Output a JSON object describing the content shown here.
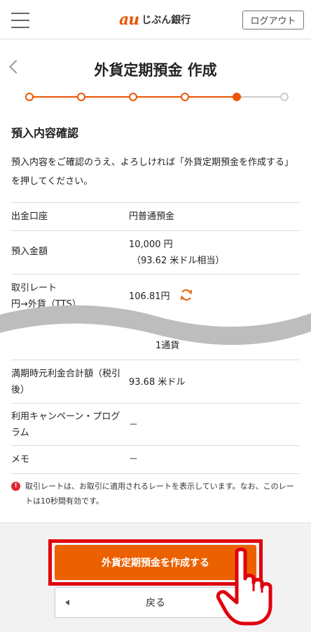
{
  "header": {
    "logo_mark": "au",
    "logo_text": "じぶん銀行",
    "logout_label": "ログアウト"
  },
  "page": {
    "title": "外貨定期預金 作成"
  },
  "stepper": {
    "total_steps": 6,
    "current_step": 5
  },
  "section": {
    "title": "預入内容確認",
    "intro": "預入内容をご確認のうえ、よろしければ「外貨定期預金を作成する」を押してください。"
  },
  "details": {
    "withdrawal_account": {
      "label": "出金口座",
      "value": "円普通預金"
    },
    "deposit_amount": {
      "label": "預入金額",
      "value": "10,000 円",
      "sub": "（93.62 米ドル相当）"
    },
    "rate": {
      "label": "取引レート",
      "sub_label": "円→外貨（TTS）",
      "value": "106.81円"
    },
    "hidden_row": {
      "value": "1通貨"
    },
    "maturity_total": {
      "label": "満期時元利金合計額（税引後）",
      "value": "93.68 米ドル"
    },
    "campaign": {
      "label": "利用キャンペーン・プログラム",
      "value": "－"
    },
    "memo": {
      "label": "メモ",
      "value": "－"
    }
  },
  "note": {
    "icon": "!",
    "text": "取引レートは、お取引に適用されるレートを表示しています。なお、このレートは10秒間有効です。"
  },
  "actions": {
    "primary_label": "外貨定期預金を作成する",
    "back_label": "戻る"
  },
  "colors": {
    "brand_orange": "#eb6100",
    "highlight_red": "#e0000d",
    "alert_red": "#e0262c"
  }
}
